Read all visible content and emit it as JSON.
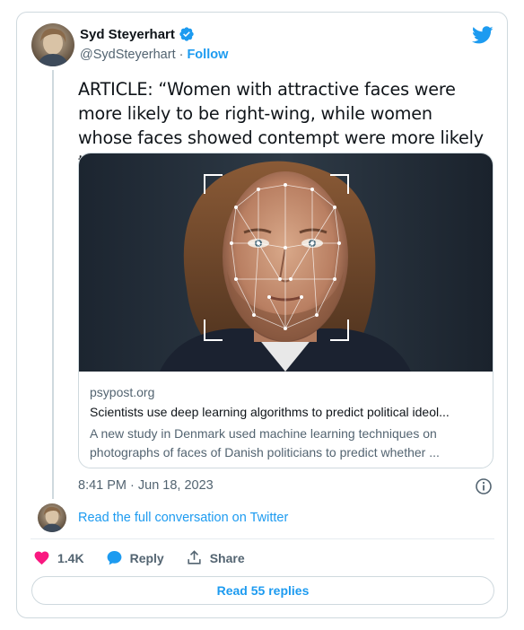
{
  "author": {
    "name": "Syd Steyerhart",
    "handle": "@SydSteyerhart",
    "separator": "·",
    "follow_label": "Follow"
  },
  "tweet": {
    "text": "ARTICLE: “Women with attractive faces were more likely to be right-wing, while women whose faces showed contempt were more likely to be left-wing.”",
    "timestamp": "8:41 PM · Jun 18, 2023"
  },
  "link_card": {
    "domain": "psypost.org",
    "title": "Scientists use deep learning algorithms to predict political ideol...",
    "description": "A new study in Denmark used machine learning techniques on photographs of faces of Danish politicians to predict whether ..."
  },
  "conversation_link": "Read the full conversation on Twitter",
  "actions": {
    "likes": "1.4K",
    "reply_label": "Reply",
    "share_label": "Share"
  },
  "read_replies_label": "Read 55 replies",
  "colors": {
    "accent": "#1d9bf0",
    "like": "#f91880",
    "text": "#0f1419",
    "muted": "#536471",
    "border": "#cfd9de"
  },
  "icons": [
    "verified-badge-icon",
    "twitter-bird-icon",
    "info-icon",
    "heart-icon",
    "reply-bubble-icon",
    "share-icon"
  ]
}
